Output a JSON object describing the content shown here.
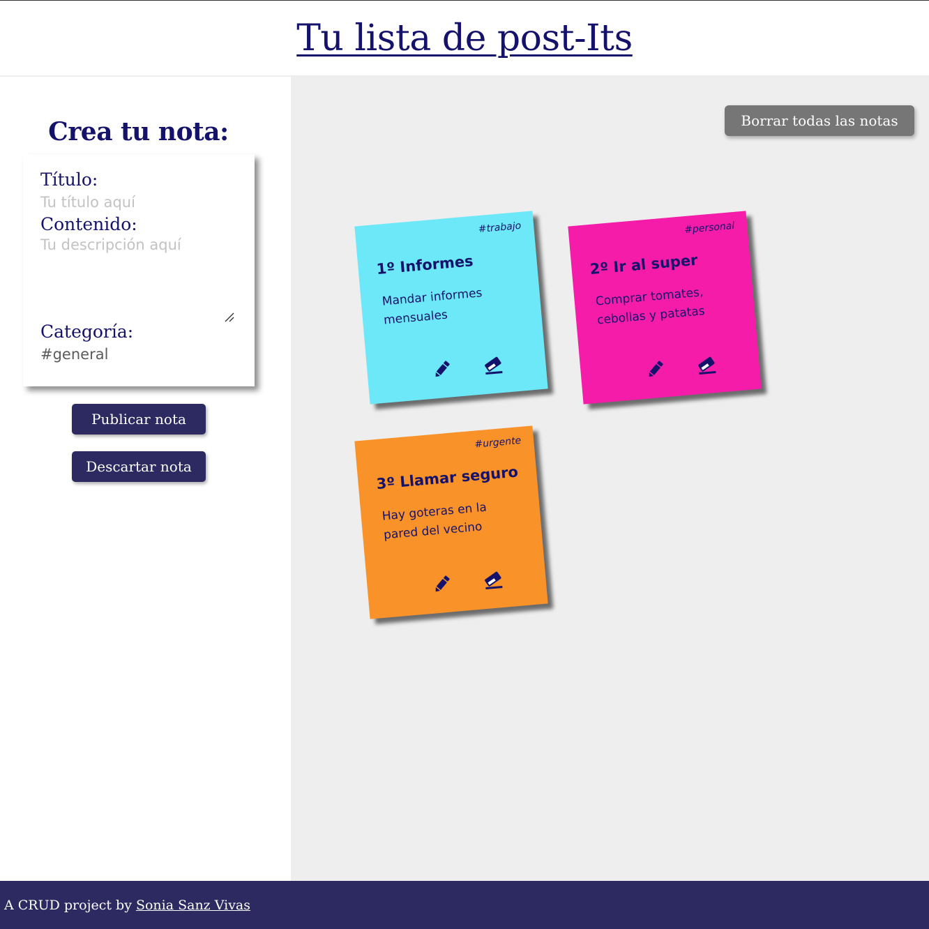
{
  "header": {
    "title": "Tu lista de post-Its"
  },
  "form": {
    "heading": "Crea tu nota:",
    "title_label": "Título:",
    "title_placeholder": "Tu título aquí",
    "content_label": "Contenido:",
    "content_placeholder": "Tu descripción aquí",
    "category_label": "Categoría:",
    "category_value": "#general",
    "publish_label": "Publicar nota",
    "discard_label": "Descartar nota"
  },
  "board": {
    "clear_all_label": "Borrar todas las notas",
    "notes": [
      {
        "tag": "#trabajo",
        "title": "1º Informes",
        "body": "Mandar informes mensuales",
        "color": "#6ce8f8",
        "edit_icon": "pencil-icon",
        "delete_icon": "eraser-icon"
      },
      {
        "tag": "#personal",
        "title": "2º Ir al super",
        "body": "Comprar tomates, cebollas y patatas",
        "color": "#f41ca8",
        "edit_icon": "pencil-icon",
        "delete_icon": "eraser-icon"
      },
      {
        "tag": "#urgente",
        "title": "3º Llamar seguro",
        "body": "Hay goteras en la pared del vecino",
        "color": "#fa922a",
        "edit_icon": "pencil-icon",
        "delete_icon": "eraser-icon"
      }
    ]
  },
  "footer": {
    "prefix": "A CRUD project by",
    "author": "Sonia Sanz Vivas"
  },
  "colors": {
    "primary": "#14126b",
    "button": "#2d2a62",
    "board": "#eeeeee",
    "clear_button": "#767676"
  }
}
